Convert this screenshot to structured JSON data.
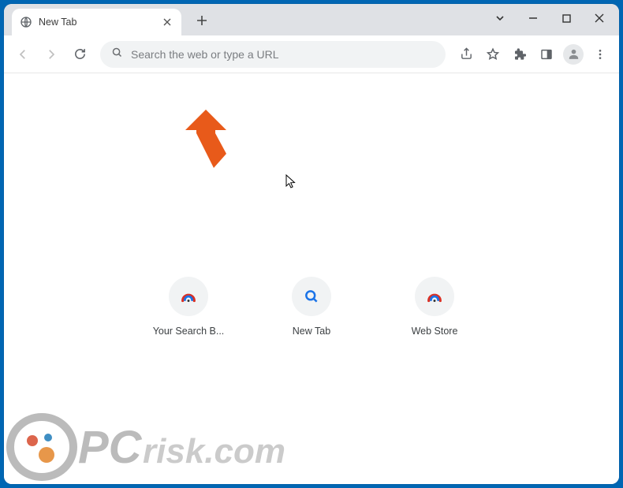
{
  "tab": {
    "title": "New Tab"
  },
  "omnibox": {
    "placeholder": "Search the web or type a URL"
  },
  "shortcuts": [
    {
      "label": "Your Search B..."
    },
    {
      "label": "New Tab"
    },
    {
      "label": "Web Store"
    }
  ],
  "watermark": {
    "text_prefix": "PC",
    "text_suffix": "risk.com"
  }
}
